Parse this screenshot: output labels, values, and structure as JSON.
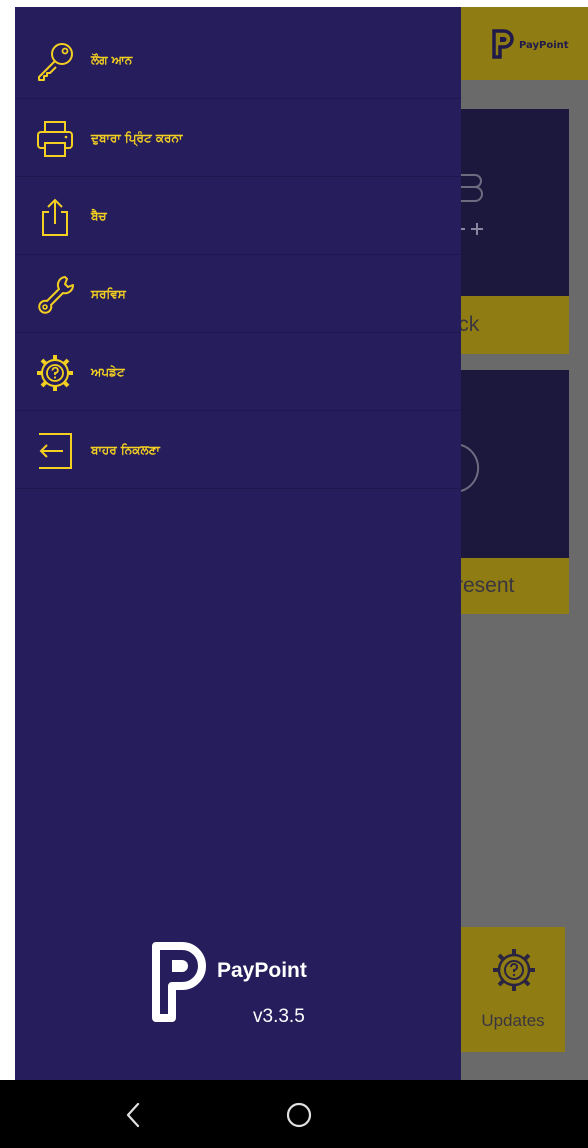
{
  "background_app": {
    "header_brand": "PayPoint",
    "tile_buttons": [
      "ashback",
      "resent"
    ],
    "updates_label": "Updates",
    "colors": {
      "tile_bg": "#1c183d",
      "button_bg": "#8f7c13",
      "scrim": "#6a6a6a"
    }
  },
  "drawer": {
    "menu": [
      {
        "label": "ਲੌਗ ਆਨ",
        "icon": "key-icon"
      },
      {
        "label": "ਦੁਬਾਰਾ ਪ੍ਰਿੰਟ ਕਰਨਾ",
        "icon": "printer-icon"
      },
      {
        "label": "ਬੈਚ",
        "icon": "share-upload-icon"
      },
      {
        "label": "ਸਰਵਿਸ",
        "icon": "wrench-icon"
      },
      {
        "label": "ਅਪਡੇਟ",
        "icon": "gear-question-icon"
      },
      {
        "label": "ਬਾਹਰ ਨਿਕਲਣਾ",
        "icon": "exit-icon"
      }
    ],
    "brand_name": "PayPoint",
    "version": "v3.3.5",
    "colors": {
      "background": "#261e5c",
      "accent": "#f2cf21"
    }
  },
  "navbar": {
    "back_icon": "back-chevron-icon",
    "home_icon": "home-circle-icon"
  }
}
